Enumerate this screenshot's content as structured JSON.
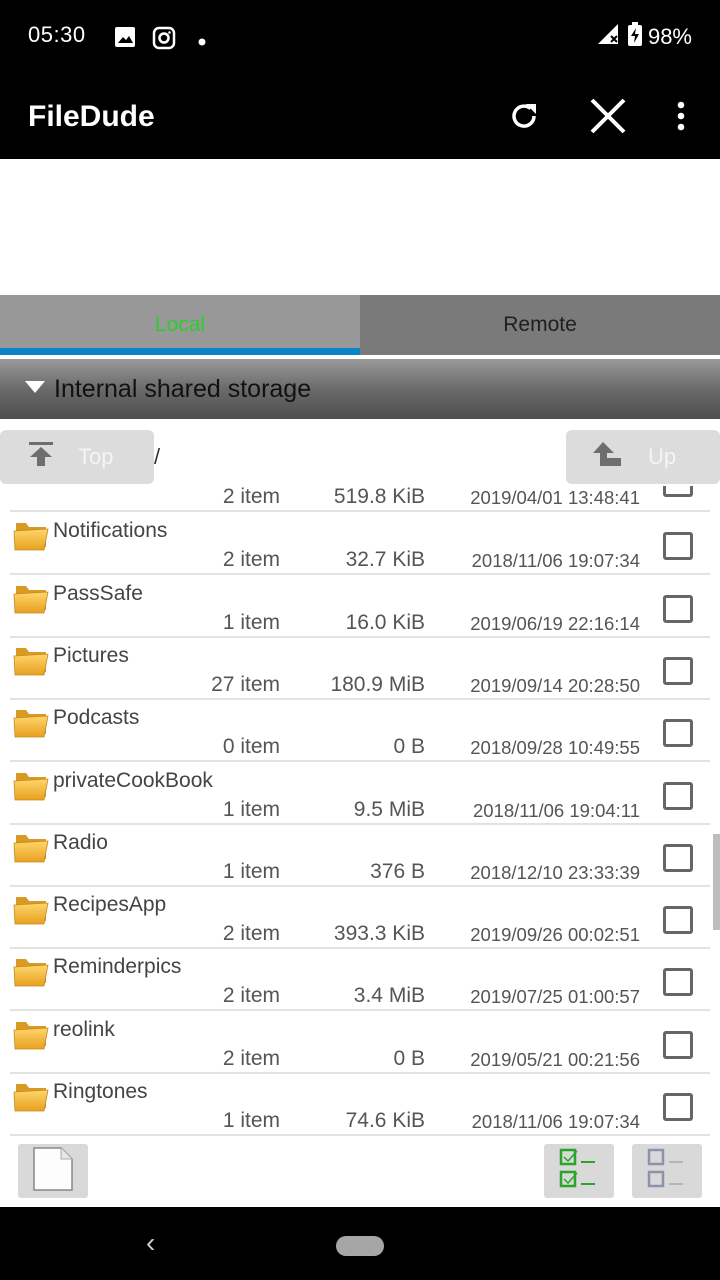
{
  "status_bar": {
    "time": "05:30",
    "battery": "98%",
    "left_icons": [
      "image-notification-icon",
      "instagram-icon",
      "dot-icon"
    ],
    "right_icons": [
      "signal-no-service-icon",
      "battery-charging-icon"
    ]
  },
  "app_bar": {
    "title": "FileDude",
    "actions": [
      "refresh-icon",
      "close-icon",
      "more-vert-icon"
    ]
  },
  "tabs": [
    {
      "label": "Local",
      "active": true
    },
    {
      "label": "Remote",
      "active": false
    }
  ],
  "storage": {
    "label": "Internal shared storage",
    "expanded": true
  },
  "navigation": {
    "top_label": "Top",
    "up_label": "Up",
    "path": "/"
  },
  "files": [
    {
      "name": "",
      "count": "2 item",
      "size": "519.8 KiB",
      "date": "2019/04/01 13:48:41",
      "checked": false,
      "partial": true
    },
    {
      "name": "Notifications",
      "count": "2 item",
      "size": "32.7 KiB",
      "date": "2018/11/06 19:07:34",
      "checked": false
    },
    {
      "name": "PassSafe",
      "count": "1 item",
      "size": "16.0 KiB",
      "date": "2019/06/19 22:16:14",
      "checked": false
    },
    {
      "name": "Pictures",
      "count": "27 item",
      "size": "180.9 MiB",
      "date": "2019/09/14 20:28:50",
      "checked": false
    },
    {
      "name": "Podcasts",
      "count": "0 item",
      "size": "0 B",
      "date": "2018/09/28 10:49:55",
      "checked": false
    },
    {
      "name": "privateCookBook",
      "count": "1 item",
      "size": "9.5 MiB",
      "date": "2018/11/06 19:04:11",
      "checked": false
    },
    {
      "name": "Radio",
      "count": "1 item",
      "size": "376 B",
      "date": "2018/12/10 23:33:39",
      "checked": false
    },
    {
      "name": "RecipesApp",
      "count": "2 item",
      "size": "393.3 KiB",
      "date": "2019/09/26 00:02:51",
      "checked": false
    },
    {
      "name": "Reminderpics",
      "count": "2 item",
      "size": "3.4 MiB",
      "date": "2019/07/25 01:00:57",
      "checked": false
    },
    {
      "name": "reolink",
      "count": "2 item",
      "size": "0 B",
      "date": "2019/05/21 00:21:56",
      "checked": false
    },
    {
      "name": "Ringtones",
      "count": "1 item",
      "size": "74.6 KiB",
      "date": "2018/11/06 19:07:34",
      "checked": false
    }
  ],
  "bottom_bar": {
    "buttons": [
      "new-file-icon",
      "select-all-icon",
      "deselect-all-icon"
    ]
  },
  "colors": {
    "active_tab_text": "#2ecc2e",
    "tab_indicator": "#0a84c9",
    "select_all": "#2aa52a",
    "deselect_all": "#8a94a8"
  }
}
